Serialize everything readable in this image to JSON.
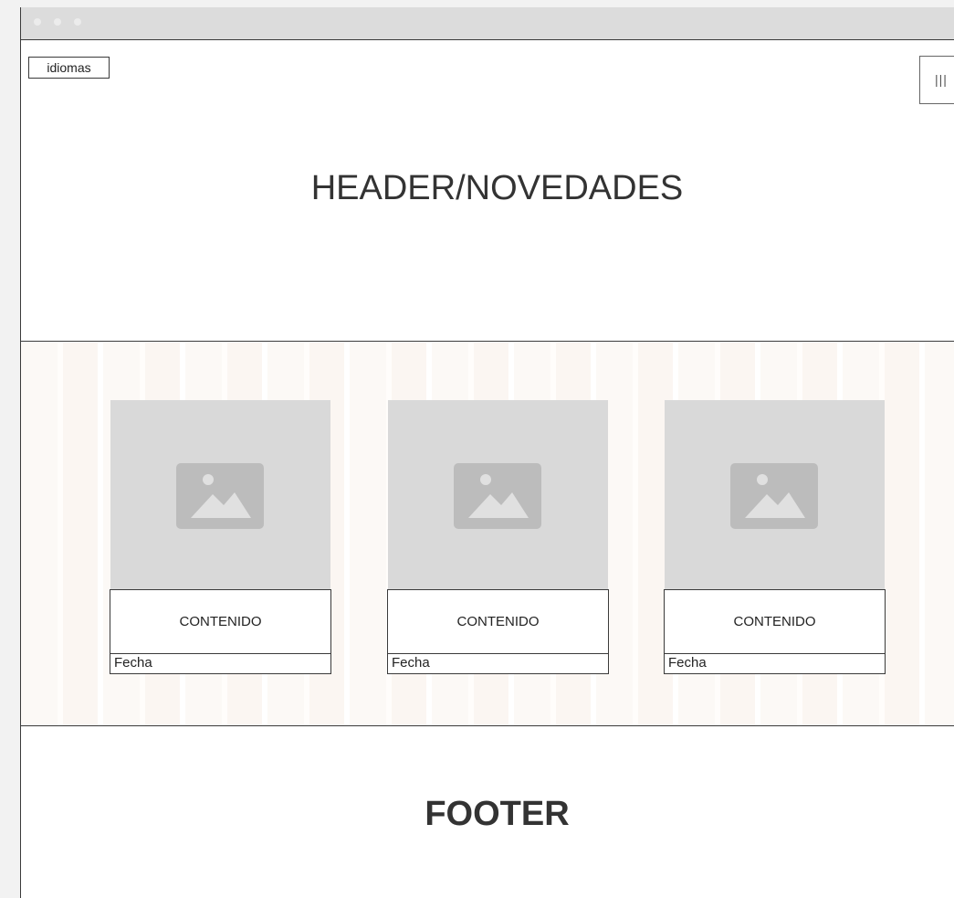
{
  "header": {
    "language_button": "idiomas",
    "menu_button": "|||",
    "title": "HEADER/NOVEDADES"
  },
  "cards": [
    {
      "content": "CONTENIDO",
      "date": "Fecha",
      "image_icon": "image-placeholder-icon"
    },
    {
      "content": "CONTENIDO",
      "date": "Fecha",
      "image_icon": "image-placeholder-icon"
    },
    {
      "content": "CONTENIDO",
      "date": "Fecha",
      "image_icon": "image-placeholder-icon"
    }
  ],
  "footer": {
    "title": "FOOTER"
  },
  "colors": {
    "border": "#3a3a3a",
    "image_placeholder": "#d9d9d9",
    "image_icon": "#bcbcbc"
  }
}
